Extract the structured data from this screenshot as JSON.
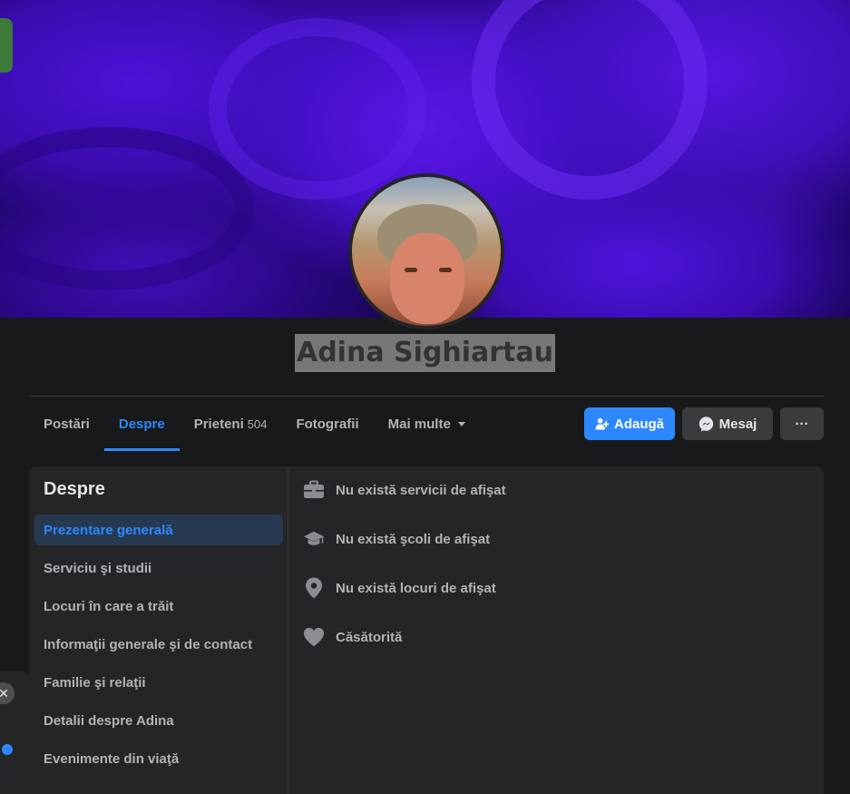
{
  "profile": {
    "name": "Adina Sighiartau"
  },
  "tabs": [
    {
      "label": "Postări",
      "active": false
    },
    {
      "label": "Despre",
      "active": true
    },
    {
      "label": "Prieteni",
      "count": "504",
      "active": false
    },
    {
      "label": "Fotografii",
      "active": false
    },
    {
      "label": "Mai multe",
      "active": false
    }
  ],
  "actions": {
    "add_label": "Adaugă",
    "message_label": "Mesaj",
    "more_label": "···"
  },
  "about": {
    "title": "Despre",
    "menu": [
      {
        "label": "Prezentare generală",
        "active": true
      },
      {
        "label": "Serviciu şi studii"
      },
      {
        "label": "Locuri în care a trăit"
      },
      {
        "label": "Informaţii generale şi de contact"
      },
      {
        "label": "Familie şi relaţii"
      },
      {
        "label": "Detalii despre Adina"
      },
      {
        "label": "Evenimente din viaţă"
      }
    ],
    "overview": [
      {
        "icon": "briefcase-icon",
        "text": "Nu există servicii de afişat"
      },
      {
        "icon": "graduation-cap-icon",
        "text": "Nu există şcoli de afişat"
      },
      {
        "icon": "location-pin-icon",
        "text": "Nu există locuri de afişat"
      },
      {
        "icon": "heart-icon",
        "text": "Căsătorită"
      }
    ]
  },
  "colors": {
    "accent": "#2d88ff",
    "background": "#18191a",
    "card": "#242526",
    "muted_text": "#b0b3b8"
  },
  "side": {
    "close_label": "✕"
  }
}
